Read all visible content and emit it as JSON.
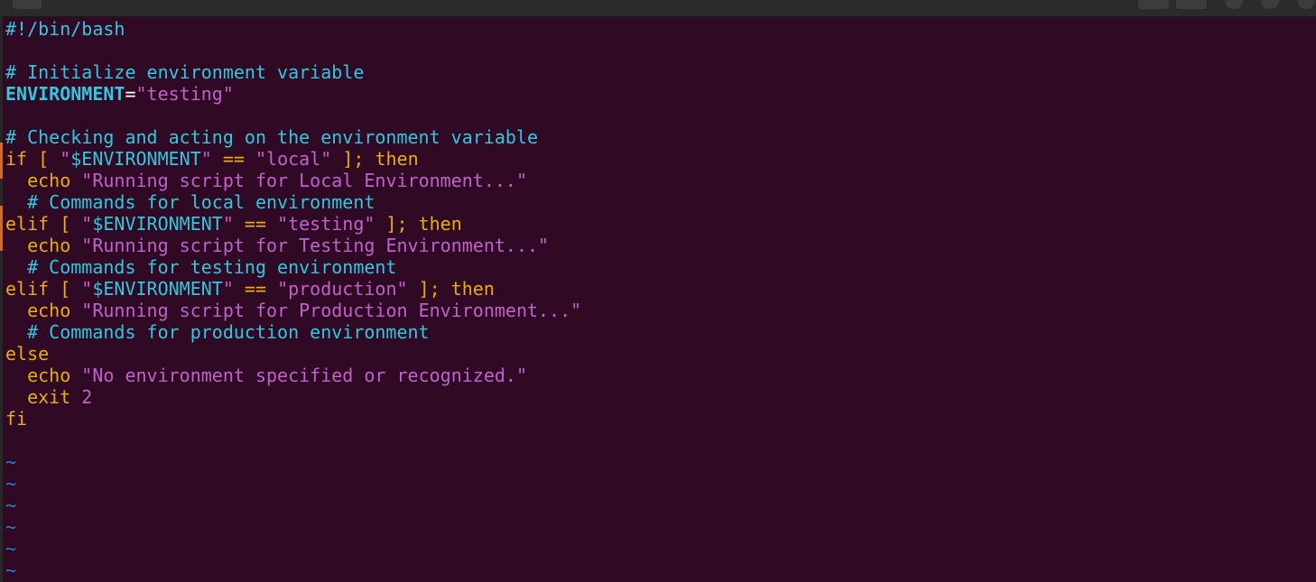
{
  "window": {
    "title": "",
    "theme_colors": {
      "background": "#300a24",
      "comment": "#33c7de",
      "keyword": "#e9ad0c",
      "string": "#c061cb",
      "tilde": "#2a7bde"
    }
  },
  "titlebar": {
    "left_button_icon": "menu-icon",
    "search_button_icon": "search-icon",
    "hamburger_button_icon": "hamburger-icon",
    "window_controls": [
      "minimize-icon",
      "maximize-icon",
      "close-icon"
    ]
  },
  "editor": {
    "lines": [
      [
        {
          "t": "comment",
          "v": "#!/bin/bash"
        }
      ],
      [],
      [
        {
          "t": "comment",
          "v": "# Initialize environment variable"
        }
      ],
      [
        {
          "t": "ident",
          "v": "ENVIRONMENT"
        },
        {
          "t": "op",
          "v": "="
        },
        {
          "t": "string",
          "v": "\"testing\""
        }
      ],
      [],
      [
        {
          "t": "comment",
          "v": "# Checking and acting on the environment variable"
        }
      ],
      [
        {
          "t": "keyword",
          "v": "if [ "
        },
        {
          "t": "string",
          "v": "\""
        },
        {
          "t": "var",
          "v": "$ENVIRONMENT"
        },
        {
          "t": "string",
          "v": "\""
        },
        {
          "t": "keyword",
          "v": " == "
        },
        {
          "t": "string",
          "v": "\"local\""
        },
        {
          "t": "keyword",
          "v": " ]; then"
        }
      ],
      [
        {
          "t": "keyword",
          "v": "  echo "
        },
        {
          "t": "string",
          "v": "\"Running script for Local Environment...\""
        }
      ],
      [
        {
          "t": "comment",
          "v": "  # Commands for local environment"
        }
      ],
      [
        {
          "t": "keyword",
          "v": "elif [ "
        },
        {
          "t": "string",
          "v": "\""
        },
        {
          "t": "var",
          "v": "$ENVIRONMENT"
        },
        {
          "t": "string",
          "v": "\""
        },
        {
          "t": "keyword",
          "v": " == "
        },
        {
          "t": "string",
          "v": "\"testing\""
        },
        {
          "t": "keyword",
          "v": " ]; then"
        }
      ],
      [
        {
          "t": "keyword",
          "v": "  echo "
        },
        {
          "t": "string",
          "v": "\"Running script for Testing Environment...\""
        }
      ],
      [
        {
          "t": "comment",
          "v": "  # Commands for testing environment"
        }
      ],
      [
        {
          "t": "keyword",
          "v": "elif [ "
        },
        {
          "t": "string",
          "v": "\""
        },
        {
          "t": "var",
          "v": "$ENVIRONMENT"
        },
        {
          "t": "string",
          "v": "\""
        },
        {
          "t": "keyword",
          "v": " == "
        },
        {
          "t": "string",
          "v": "\"production\""
        },
        {
          "t": "keyword",
          "v": " ]; then"
        }
      ],
      [
        {
          "t": "keyword",
          "v": "  echo "
        },
        {
          "t": "string",
          "v": "\"Running script for Production Environment...\""
        }
      ],
      [
        {
          "t": "comment",
          "v": "  # Commands for production environment"
        }
      ],
      [
        {
          "t": "keyword",
          "v": "else"
        }
      ],
      [
        {
          "t": "keyword",
          "v": "  echo "
        },
        {
          "t": "string",
          "v": "\"No environment specified or recognized.\""
        }
      ],
      [
        {
          "t": "keyword",
          "v": "  exit "
        },
        {
          "t": "number",
          "v": "2"
        }
      ],
      [
        {
          "t": "keyword",
          "v": "fi"
        }
      ],
      [],
      [
        {
          "t": "tilde",
          "v": "~"
        }
      ],
      [
        {
          "t": "tilde",
          "v": "~"
        }
      ],
      [
        {
          "t": "tilde",
          "v": "~"
        }
      ],
      [
        {
          "t": "tilde",
          "v": "~"
        }
      ],
      [
        {
          "t": "tilde",
          "v": "~"
        }
      ],
      [
        {
          "t": "tilde",
          "v": "~"
        }
      ]
    ]
  }
}
